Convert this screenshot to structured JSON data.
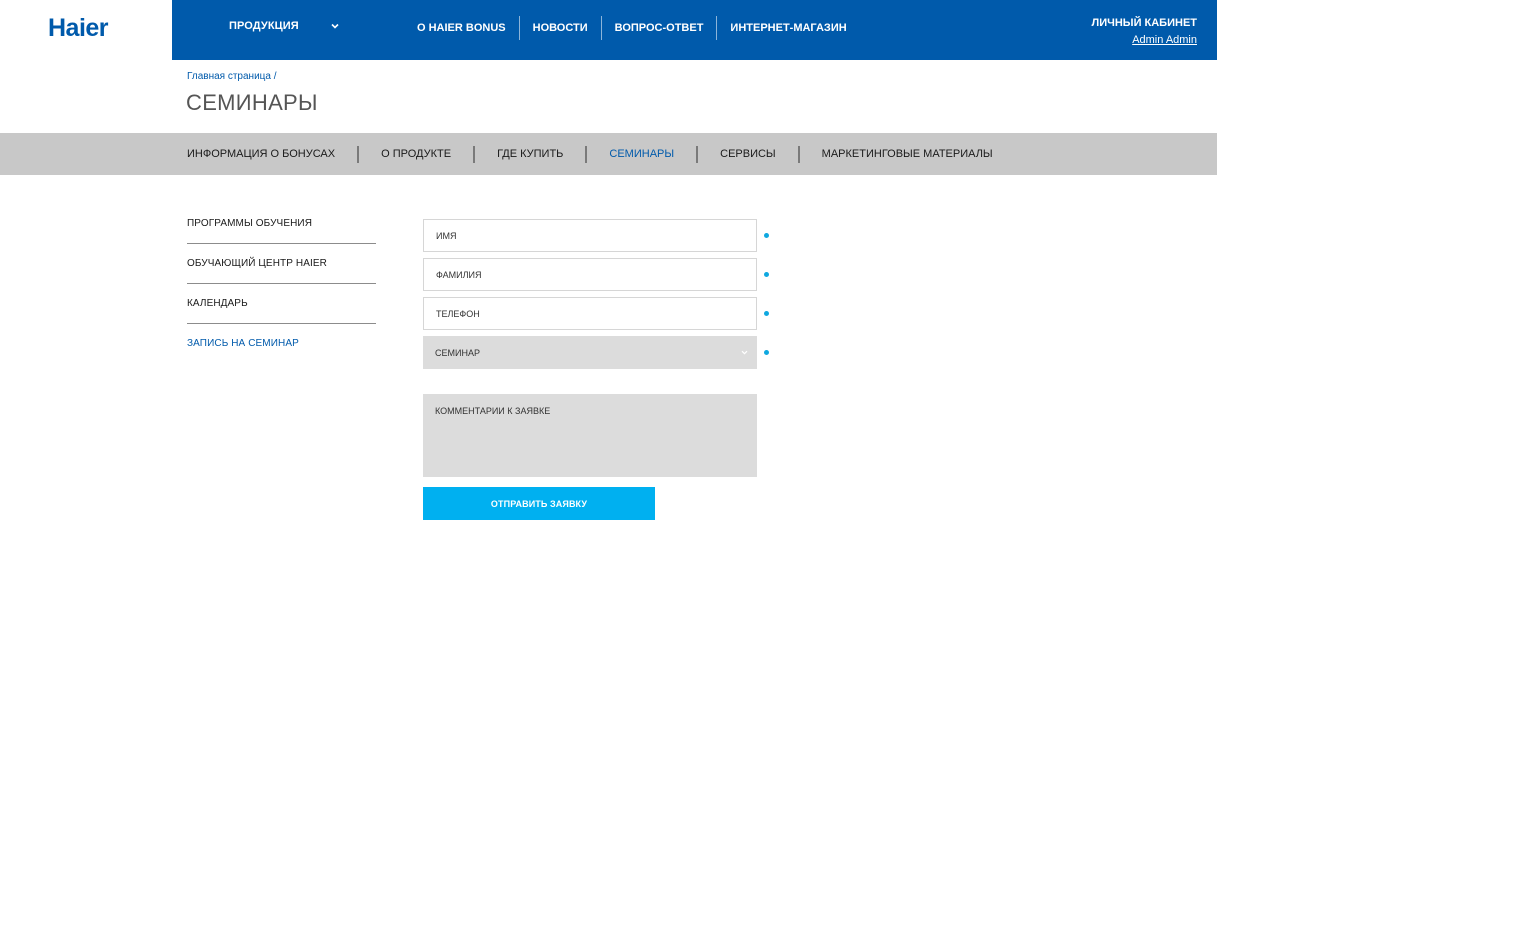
{
  "header": {
    "logo": "Haier",
    "products_label": "ПРОДУКЦИЯ",
    "nav": [
      "О HAIER BONUS",
      "НОВОСТИ",
      "ВОПРОС-ОТВЕТ",
      "ИНТЕРНЕТ-МАГАЗИН"
    ],
    "account_title": "ЛИЧНЫЙ КАБИНЕТ",
    "account_user": "Admin Admin"
  },
  "breadcrumb": {
    "home": "Главная страница",
    "separator": "/"
  },
  "page_title": "СЕМИНАРЫ",
  "subnav": {
    "items": [
      "ИНФОРМАЦИЯ О БОНУСАХ",
      "О ПРОДУКТЕ",
      "ГДЕ КУПИТЬ",
      "СЕМИНАРЫ",
      "СЕРВИСЫ",
      "МАРКЕТИНГОВЫЕ МАТЕРИАЛЫ"
    ],
    "active": "СЕМИНАРЫ"
  },
  "side_menu": {
    "items": [
      "ПРОГРАММЫ ОБУЧЕНИЯ",
      "ОБУЧАЮЩИЙ ЦЕНТР HAIER",
      "КАЛЕНДАРЬ",
      "ЗАПИСЬ НА СЕМИНАР"
    ]
  },
  "form": {
    "name_placeholder": "ИМЯ",
    "surname_placeholder": "ФАМИЛИЯ",
    "phone_placeholder": "ТЕЛЕФОН",
    "seminar_select": "СЕМИНАР",
    "comment_placeholder": "КОММЕНТАРИИ К ЗАЯВКЕ",
    "submit_label": "ОТПРАВИТЬ ЗАЯВКУ"
  },
  "colors": {
    "brand_blue": "#005aab",
    "accent_cyan": "#00b0f0",
    "subnav_bg": "#c8c8c8",
    "field_gray": "#dcdcdc"
  }
}
